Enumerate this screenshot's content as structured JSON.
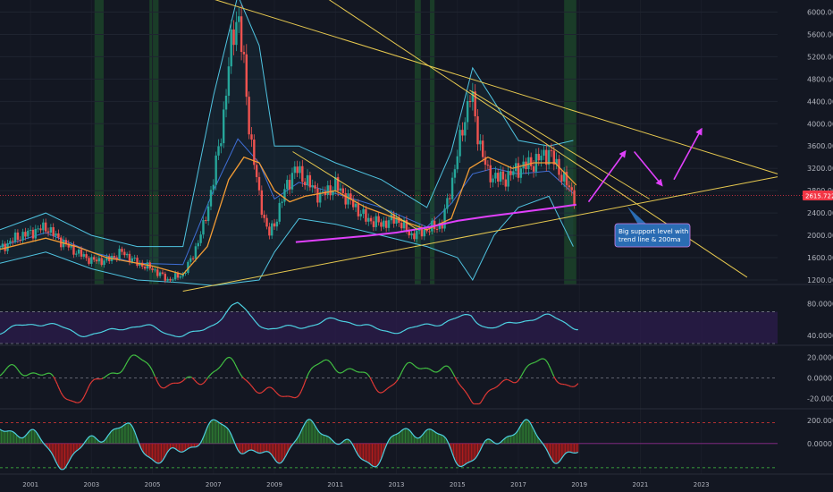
{
  "chart_data": {
    "type": "candlestick",
    "price_axis": {
      "ticks": [
        "1200.000",
        "1600.000",
        "2000.000",
        "2400.000",
        "2800.000",
        "3200.000",
        "3600.000",
        "4000.000",
        "4400.000",
        "4800.000",
        "5200.000",
        "5600.000",
        "6000.000"
      ],
      "tick_values": [
        1200,
        1600,
        2000,
        2400,
        2800,
        3200,
        3600,
        4000,
        4400,
        4800,
        5200,
        5600,
        6000
      ],
      "range": [
        1120,
        6120
      ]
    },
    "last_price": "2615.722",
    "annotation": {
      "lines": [
        "Big support level with",
        "trend line & 200ma"
      ]
    },
    "x_axis": {
      "labels": [
        "2001",
        "2003",
        "2005",
        "2007",
        "2009",
        "2011",
        "2013",
        "2015",
        "2017",
        "2019",
        "2021",
        "2023"
      ],
      "years": [
        2001,
        2003,
        2005,
        2007,
        2009,
        2011,
        2013,
        2015,
        2017,
        2019,
        2021,
        2023
      ],
      "range": [
        2000.0,
        2025.5
      ]
    },
    "price_series": [
      [
        2000.0,
        1750
      ],
      [
        2000.5,
        1950
      ],
      [
        2001.0,
        2050
      ],
      [
        2001.5,
        2150
      ],
      [
        2002.0,
        1900
      ],
      [
        2002.5,
        1700
      ],
      [
        2003.0,
        1550
      ],
      [
        2003.5,
        1550
      ],
      [
        2004.0,
        1700
      ],
      [
        2004.5,
        1500
      ],
      [
        2005.0,
        1400
      ],
      [
        2005.5,
        1200
      ],
      [
        2006.0,
        1300
      ],
      [
        2006.3,
        1600
      ],
      [
        2006.7,
        2200
      ],
      [
        2007.0,
        3000
      ],
      [
        2007.3,
        4000
      ],
      [
        2007.6,
        5500
      ],
      [
        2007.8,
        6000
      ],
      [
        2008.0,
        5000
      ],
      [
        2008.2,
        3800
      ],
      [
        2008.5,
        2700
      ],
      [
        2008.8,
        2000
      ],
      [
        2009.0,
        2200
      ],
      [
        2009.4,
        2900
      ],
      [
        2009.7,
        3200
      ],
      [
        2010.0,
        3000
      ],
      [
        2010.5,
        2700
      ],
      [
        2011.0,
        2900
      ],
      [
        2011.5,
        2600
      ],
      [
        2012.0,
        2300
      ],
      [
        2012.5,
        2200
      ],
      [
        2013.0,
        2300
      ],
      [
        2013.5,
        2000
      ],
      [
        2014.0,
        2100
      ],
      [
        2014.5,
        2200
      ],
      [
        2014.8,
        2900
      ],
      [
        2015.2,
        4000
      ],
      [
        2015.45,
        4600
      ],
      [
        2015.6,
        4000
      ],
      [
        2015.8,
        3500
      ],
      [
        2016.0,
        3100
      ],
      [
        2016.5,
        3000
      ],
      [
        2017.0,
        3200
      ],
      [
        2017.5,
        3300
      ],
      [
        2018.0,
        3500
      ],
      [
        2018.5,
        3000
      ],
      [
        2018.9,
        2620
      ]
    ],
    "ma_orange": [
      [
        2000.0,
        1750
      ],
      [
        2001.5,
        1950
      ],
      [
        2002.5,
        1800
      ],
      [
        2003.5,
        1600
      ],
      [
        2005.0,
        1450
      ],
      [
        2006.0,
        1300
      ],
      [
        2006.8,
        1800
      ],
      [
        2007.5,
        3000
      ],
      [
        2008.0,
        3400
      ],
      [
        2008.5,
        3300
      ],
      [
        2009.0,
        2800
      ],
      [
        2009.5,
        2600
      ],
      [
        2010.0,
        2700
      ],
      [
        2011.0,
        2800
      ],
      [
        2012.0,
        2500
      ],
      [
        2013.0,
        2300
      ],
      [
        2014.0,
        2100
      ],
      [
        2014.8,
        2300
      ],
      [
        2015.4,
        3200
      ],
      [
        2016.0,
        3400
      ],
      [
        2016.8,
        3200
      ],
      [
        2017.5,
        3300
      ],
      [
        2018.2,
        3300
      ],
      [
        2018.9,
        2900
      ]
    ],
    "ma_pink_200": [
      [
        2009.7,
        1880
      ],
      [
        2011.0,
        1940
      ],
      [
        2012.0,
        1990
      ],
      [
        2013.0,
        2050
      ],
      [
        2014.0,
        2140
      ],
      [
        2015.0,
        2260
      ],
      [
        2016.0,
        2340
      ],
      [
        2017.0,
        2410
      ],
      [
        2018.0,
        2480
      ],
      [
        2018.9,
        2550
      ]
    ],
    "bollinger_upper": [
      [
        2000.0,
        2100
      ],
      [
        2001.5,
        2400
      ],
      [
        2003.0,
        2000
      ],
      [
        2004.5,
        1800
      ],
      [
        2006.0,
        1800
      ],
      [
        2007.0,
        4500
      ],
      [
        2007.8,
        6300
      ],
      [
        2008.5,
        5400
      ],
      [
        2009.0,
        3600
      ],
      [
        2009.8,
        3600
      ],
      [
        2011.0,
        3300
      ],
      [
        2012.5,
        3000
      ],
      [
        2014.0,
        2500
      ],
      [
        2014.8,
        3500
      ],
      [
        2015.5,
        5000
      ],
      [
        2016.2,
        4400
      ],
      [
        2017.0,
        3700
      ],
      [
        2018.0,
        3600
      ],
      [
        2018.8,
        3700
      ]
    ],
    "bollinger_lower": [
      [
        2000.0,
        1500
      ],
      [
        2001.5,
        1700
      ],
      [
        2003.0,
        1400
      ],
      [
        2004.5,
        1200
      ],
      [
        2006.0,
        1150
      ],
      [
        2007.0,
        1100
      ],
      [
        2008.5,
        1200
      ],
      [
        2009.0,
        1700
      ],
      [
        2009.8,
        2300
      ],
      [
        2011.0,
        2200
      ],
      [
        2012.5,
        2000
      ],
      [
        2014.0,
        1800
      ],
      [
        2015.0,
        1600
      ],
      [
        2015.5,
        1200
      ],
      [
        2016.2,
        2000
      ],
      [
        2017.0,
        2500
      ],
      [
        2018.0,
        2700
      ],
      [
        2018.8,
        1800
      ]
    ],
    "trend_lines": [
      {
        "color": "#e6c84f",
        "points": [
          [
            2006.0,
            1000
          ],
          [
            2025.5,
            3050
          ]
        ]
      },
      {
        "color": "#e6c84f",
        "points": [
          [
            2006.0,
            6400
          ],
          [
            2025.5,
            3100
          ]
        ]
      },
      {
        "color": "#e6c84f",
        "points": [
          [
            2009.6,
            3500
          ],
          [
            2013.7,
            2100
          ]
        ]
      },
      {
        "color": "#e6c84f",
        "points": [
          [
            2010.3,
            6400
          ],
          [
            2024.5,
            1250
          ]
        ]
      },
      {
        "color": "#e6c84f",
        "points": [
          [
            2015.4,
            4600
          ],
          [
            2021.3,
            2650
          ]
        ]
      }
    ],
    "projection_arrows": [
      {
        "color": "#e040fb",
        "points": [
          [
            2019.3,
            2600
          ],
          [
            2020.5,
            3500
          ]
        ]
      },
      {
        "color": "#e040fb",
        "points": [
          [
            2020.8,
            3500
          ],
          [
            2021.7,
            2900
          ]
        ]
      },
      {
        "color": "#e040fb",
        "points": [
          [
            2022.1,
            3000
          ],
          [
            2023.0,
            3900
          ]
        ]
      }
    ],
    "highlight_bands": [
      [
        2003.1,
        2003.4
      ],
      [
        2004.9,
        2005.2
      ],
      [
        2013.6,
        2013.8
      ],
      [
        2014.1,
        2014.25
      ],
      [
        2018.5,
        2018.9
      ]
    ],
    "rsi_panel": {
      "ticks": [
        "80.0000",
        "40.0000"
      ],
      "tick_values": [
        80,
        40
      ],
      "range": [
        30,
        100
      ],
      "upper": 70,
      "lower": 30
    },
    "momentum_panel": {
      "ticks": [
        "20.0000",
        "0.0000",
        "-20.0000"
      ],
      "tick_values": [
        20,
        0,
        -20
      ],
      "range": [
        -28,
        28
      ]
    },
    "histogram_panel": {
      "ticks": [
        "200.0000",
        "0.0000"
      ],
      "tick_values": [
        200,
        0
      ],
      "range": [
        -250,
        270
      ]
    }
  }
}
